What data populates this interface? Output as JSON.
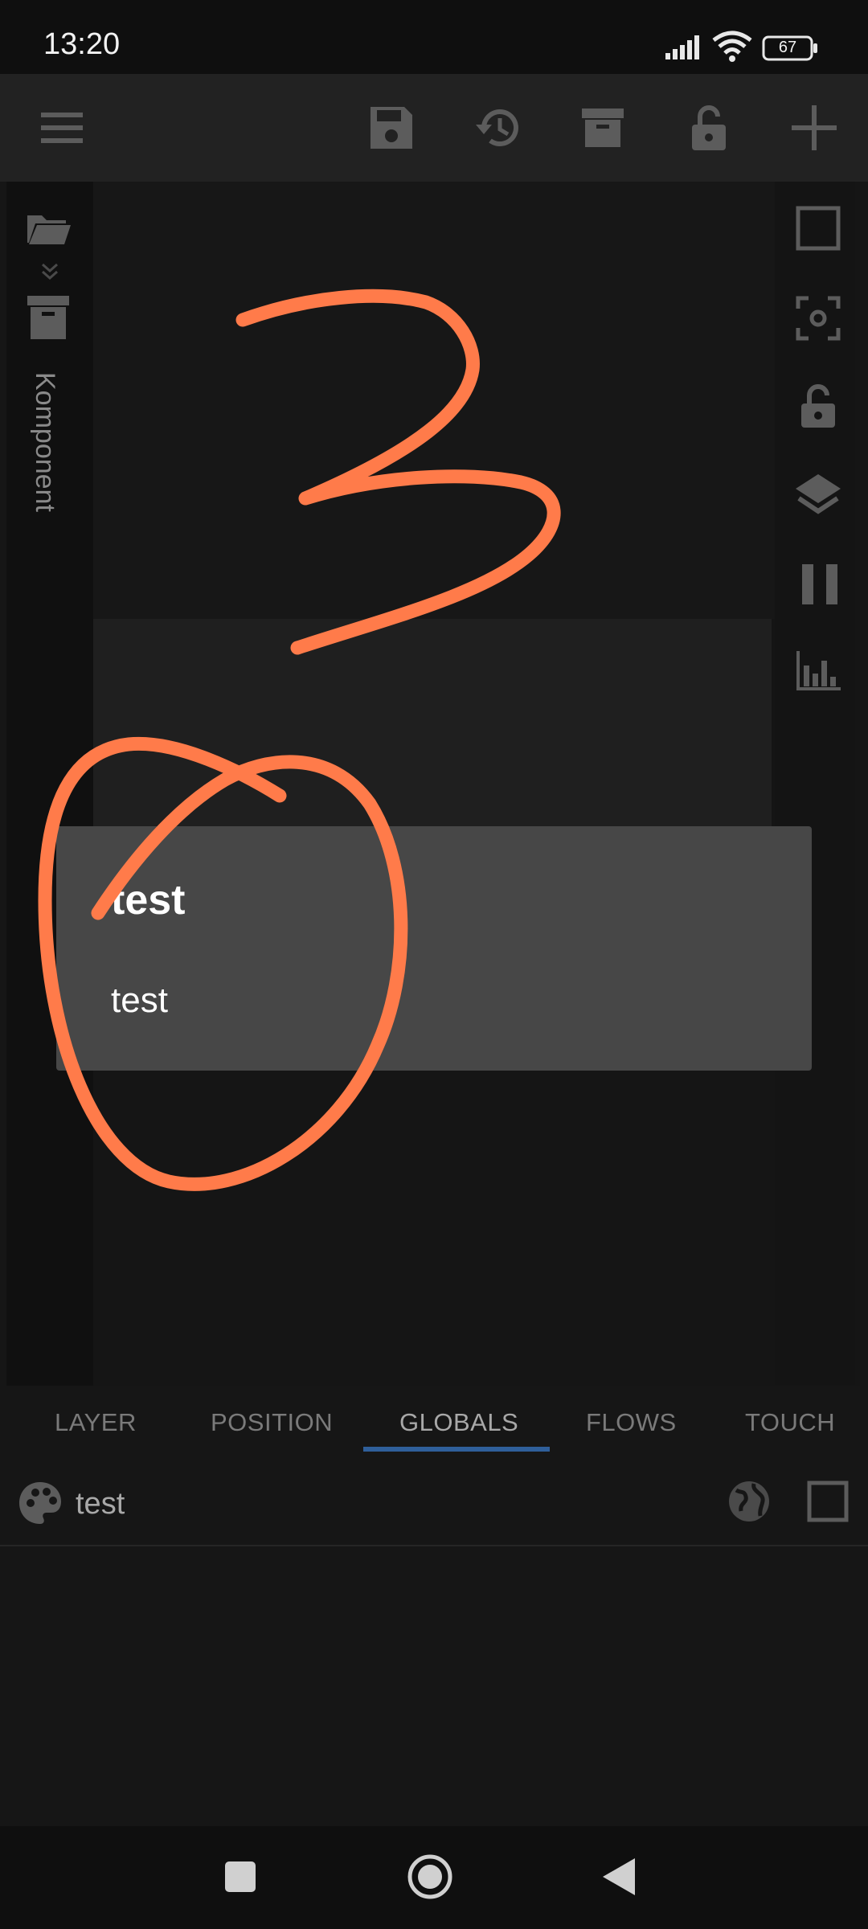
{
  "status_bar": {
    "time": "13:20",
    "battery": "67"
  },
  "toolbar": {
    "icons": [
      "menu-icon",
      "save-icon",
      "history-icon",
      "archive-icon",
      "lock-icon",
      "add-icon"
    ]
  },
  "left_panel": {
    "label": "Komponent"
  },
  "dialog": {
    "title": "test",
    "message": "test"
  },
  "tabs": [
    "LAYER",
    "POSITION",
    "GLOBALS",
    "FLOWS",
    "TOUCH"
  ],
  "active_tab": "GLOBALS",
  "globals": {
    "item_name": "test"
  },
  "annotation": {
    "digit": "3",
    "color": "#ff7b4a"
  },
  "colors": {
    "background": "#161616",
    "dialog": "#474747",
    "accent": "#2f5f9a"
  }
}
